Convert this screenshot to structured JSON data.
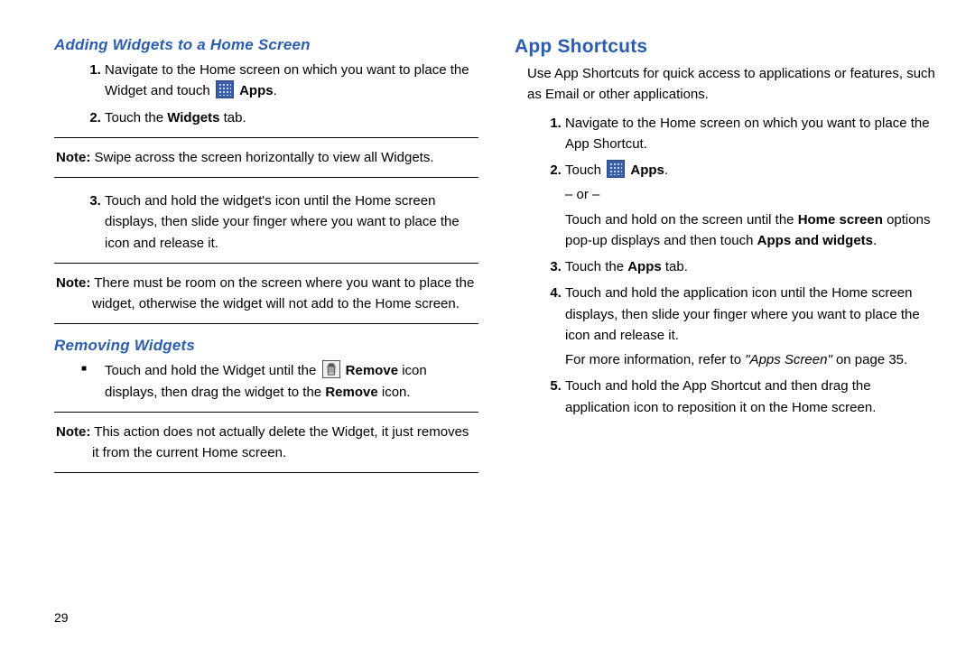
{
  "pageNumber": "29",
  "left": {
    "section1": {
      "title": "Adding Widgets to a Home Screen",
      "step1_a": "Navigate to the Home screen on which you want to place the Widget and touch ",
      "step1_b": "Apps",
      "step1_c": ".",
      "step2_a": "Touch the ",
      "step2_b": "Widgets",
      "step2_c": " tab.",
      "note1_label": "Note:",
      "note1_text": " Swipe across the screen horizontally to view all Widgets.",
      "step3": "Touch and hold the widget's icon until the Home screen displays, then slide your finger where you want to place the icon and release it.",
      "note2_label": "Note:",
      "note2_text": " There must be room on the screen where you want to place the widget, otherwise the widget will not add to the Home screen."
    },
    "section2": {
      "title": "Removing Widgets",
      "bullet_a": "Touch and hold the Widget until the ",
      "bullet_b": "Remove",
      "bullet_c": " icon displays, then drag the widget to the ",
      "bullet_d": "Remove",
      "bullet_e": " icon.",
      "note_label": "Note:",
      "note_text": " This action does not actually delete the Widget, it just removes it from the current Home screen."
    }
  },
  "right": {
    "title": "App Shortcuts",
    "intro": "Use App Shortcuts for quick access to applications or features, such as Email or other applications.",
    "step1": "Navigate to the Home screen on which you want to place the App Shortcut.",
    "step2_a": "Touch ",
    "step2_b": "Apps",
    "step2_c": ".",
    "or": "– or –",
    "alt_a": "Touch and hold on the screen until the ",
    "alt_b": "Home screen",
    "alt_c": " options pop-up displays and then touch ",
    "alt_d": "Apps and widgets",
    "alt_e": ".",
    "step3_a": "Touch the ",
    "step3_b": "Apps",
    "step3_c": " tab.",
    "step4": "Touch and hold the application icon until the Home screen displays, then slide your finger where you want to place the icon and release it.",
    "ref_a": "For more information, refer to ",
    "ref_b": "\"Apps Screen\"",
    "ref_c": " on page 35.",
    "step5": "Touch and hold the App Shortcut and then drag the application icon to reposition it on the Home screen."
  }
}
